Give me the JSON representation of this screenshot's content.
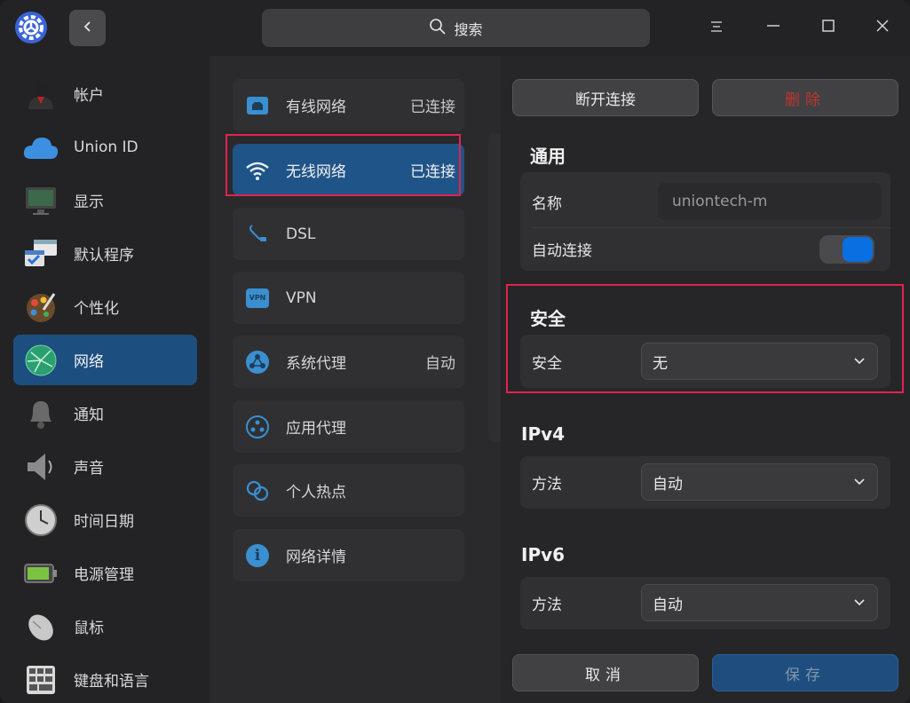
{
  "titlebar": {
    "search_label": "搜索",
    "icons": {
      "logo": "settings-gear-logo",
      "back": "chevron-left-icon",
      "menu": "menu-icon",
      "minimize": "minimize-icon",
      "maximize": "maximize-icon",
      "close": "close-icon"
    }
  },
  "nav": {
    "items": [
      {
        "label": "帐户",
        "icon": "account-icon"
      },
      {
        "label": "Union ID",
        "icon": "cloud-icon"
      },
      {
        "label": "显示",
        "icon": "display-icon"
      },
      {
        "label": "默认程序",
        "icon": "default-apps-icon"
      },
      {
        "label": "个性化",
        "icon": "personalization-icon"
      },
      {
        "label": "网络",
        "icon": "network-icon",
        "active": true
      },
      {
        "label": "通知",
        "icon": "bell-icon"
      },
      {
        "label": "声音",
        "icon": "speaker-icon"
      },
      {
        "label": "时间日期",
        "icon": "clock-icon"
      },
      {
        "label": "电源管理",
        "icon": "battery-icon"
      },
      {
        "label": "鼠标",
        "icon": "mouse-icon"
      },
      {
        "label": "键盘和语言",
        "icon": "keyboard-icon"
      }
    ]
  },
  "network_list": {
    "items": [
      {
        "label": "有线网络",
        "status": "已连接",
        "icon": "wired-icon"
      },
      {
        "label": "无线网络",
        "status": "已连接",
        "icon": "wifi-icon",
        "active": true
      },
      {
        "label": "DSL",
        "status": "",
        "icon": "dsl-icon"
      },
      {
        "label": "VPN",
        "status": "",
        "icon": "vpn-icon",
        "icon_text": "VPN"
      },
      {
        "label": "系统代理",
        "status": "自动",
        "icon": "system-proxy-icon"
      },
      {
        "label": "应用代理",
        "status": "",
        "icon": "app-proxy-icon"
      },
      {
        "label": "个人热点",
        "status": "",
        "icon": "hotspot-icon"
      },
      {
        "label": "网络详情",
        "status": "",
        "icon": "info-icon",
        "icon_text": "i"
      }
    ]
  },
  "detail": {
    "disconnect_label": "断开连接",
    "delete_label": "删除",
    "general": {
      "title": "通用",
      "name_label": "名称",
      "name_value": "uniontech-m",
      "autoconnect_label": "自动连接",
      "autoconnect_on": true
    },
    "security": {
      "title": "安全",
      "label": "安全",
      "value": "无"
    },
    "ipv4": {
      "title": "IPv4",
      "method_label": "方法",
      "method_value": "自动"
    },
    "ipv6": {
      "title": "IPv6",
      "method_label": "方法",
      "method_value": "自动"
    },
    "cancel_label": "取消",
    "save_label": "保存"
  },
  "colors": {
    "accent": "#1f5488",
    "toggle_on": "#0a6fe0",
    "danger": "#c0352c",
    "highlight": "#e0234f"
  }
}
